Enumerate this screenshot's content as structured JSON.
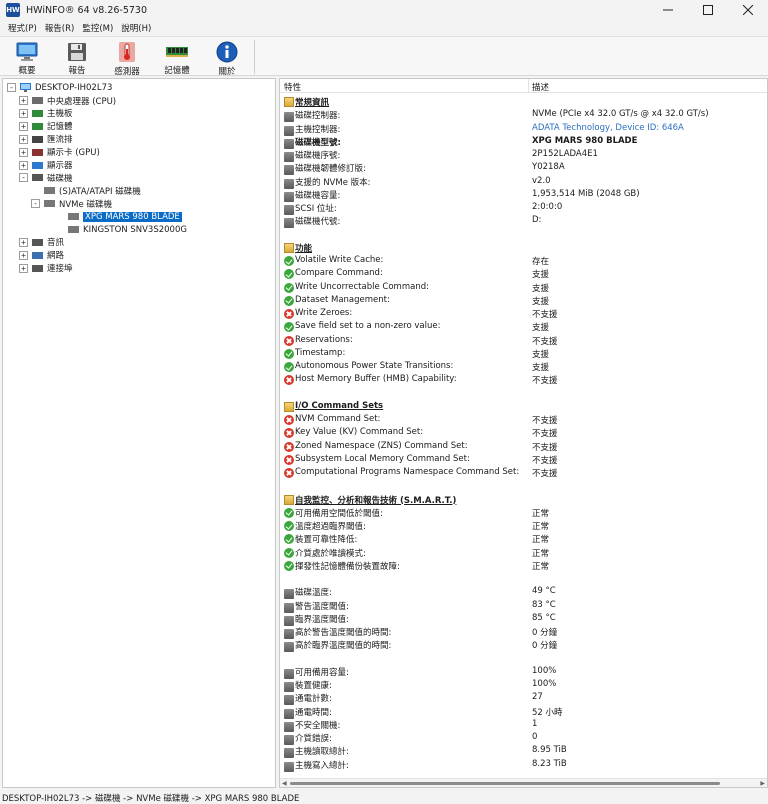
{
  "window": {
    "title": "HWiNFO® 64 v8.26-5730",
    "app_icon_text": "HW"
  },
  "menu": [
    "程式(P)",
    "報告(R)",
    "監控(M)",
    "說明(H)"
  ],
  "toolbar": [
    {
      "label": "概要",
      "icon": "monitor-icon"
    },
    {
      "label": "報告",
      "icon": "floppy-icon"
    },
    {
      "label": "感測器",
      "icon": "thermometer-icon"
    },
    {
      "label": "記憶體",
      "icon": "memory-module-icon"
    },
    {
      "label": "關於",
      "icon": "info-icon"
    }
  ],
  "tree": {
    "root": "DESKTOP-IH02L73",
    "items": [
      {
        "label": "中央處理器 (CPU)",
        "expander": "+",
        "level": 1
      },
      {
        "label": "主機板",
        "expander": "+",
        "level": 1
      },
      {
        "label": "記憶體",
        "expander": "+",
        "level": 1
      },
      {
        "label": "匯流排",
        "expander": "+",
        "level": 1
      },
      {
        "label": "顯示卡 (GPU)",
        "expander": "+",
        "level": 1
      },
      {
        "label": "顯示器",
        "expander": "+",
        "level": 1
      },
      {
        "label": "磁碟機",
        "expander": "-",
        "level": 1
      },
      {
        "label": "(S)ATA/ATAPI 磁碟機",
        "expander": "",
        "level": 2
      },
      {
        "label": "NVMe 磁碟機",
        "expander": "-",
        "level": 2
      },
      {
        "label": "XPG MARS 980 BLADE",
        "expander": "",
        "level": 3,
        "selected": true
      },
      {
        "label": "KINGSTON SNV3S2000G",
        "expander": "",
        "level": 3
      },
      {
        "label": "音訊",
        "expander": "+",
        "level": 1
      },
      {
        "label": "網路",
        "expander": "+",
        "level": 1
      },
      {
        "label": "連接埠",
        "expander": "+",
        "level": 1
      }
    ]
  },
  "details": {
    "header_feature": "特性",
    "header_desc": "描述",
    "rows": [
      {
        "t": "sec",
        "f": "常規資訊"
      },
      {
        "t": "dev",
        "f": "磁碟控制器:",
        "v": "NVMe (PCIe x4 32.0 GT/s @ x4 32.0 GT/s)"
      },
      {
        "t": "dev",
        "f": "主機控制器:",
        "v": "ADATA Technology, Device ID: 646A",
        "link": true
      },
      {
        "t": "dev",
        "f": "磁碟機型號:",
        "v": "XPG MARS 980 BLADE",
        "bold": true
      },
      {
        "t": "dev",
        "f": "磁碟機序號:",
        "v": "2P152LADA4E1"
      },
      {
        "t": "dev",
        "f": "磁碟機韌體修訂版:",
        "v": "Y0218A"
      },
      {
        "t": "dev",
        "f": "支援的 NVMe 版本:",
        "v": "v2.0"
      },
      {
        "t": "dev",
        "f": "磁碟機容量:",
        "v": "1,953,514 MiB (2048 GB)"
      },
      {
        "t": "dev",
        "f": "SCSI 位址:",
        "v": "2:0:0:0"
      },
      {
        "t": "dev",
        "f": "磁碟機代號:",
        "v": "D:"
      },
      {
        "t": "blank"
      },
      {
        "t": "sec",
        "f": "功能"
      },
      {
        "t": "ok",
        "f": "Volatile Write Cache:",
        "v": "存在"
      },
      {
        "t": "ok",
        "f": "Compare Command:",
        "v": "支援"
      },
      {
        "t": "ok",
        "f": "Write Uncorrectable Command:",
        "v": "支援"
      },
      {
        "t": "ok",
        "f": "Dataset Management:",
        "v": "支援"
      },
      {
        "t": "no",
        "f": "Write Zeroes:",
        "v": "不支援"
      },
      {
        "t": "ok",
        "f": "Save field set to a non-zero value:",
        "v": "支援"
      },
      {
        "t": "no",
        "f": "Reservations:",
        "v": "不支援"
      },
      {
        "t": "ok",
        "f": "Timestamp:",
        "v": "支援"
      },
      {
        "t": "ok",
        "f": "Autonomous Power State Transitions:",
        "v": "支援"
      },
      {
        "t": "no",
        "f": "Host Memory Buffer (HMB) Capability:",
        "v": "不支援"
      },
      {
        "t": "blank"
      },
      {
        "t": "sec",
        "f": "I/O Command Sets"
      },
      {
        "t": "no",
        "f": "NVM Command Set:",
        "v": "不支援"
      },
      {
        "t": "no",
        "f": "Key Value (KV) Command Set:",
        "v": "不支援"
      },
      {
        "t": "no",
        "f": "Zoned Namespace (ZNS) Command Set:",
        "v": "不支援"
      },
      {
        "t": "no",
        "f": "Subsystem Local Memory Command Set:",
        "v": "不支援"
      },
      {
        "t": "no",
        "f": "Computational Programs Namespace Command Set:",
        "v": "不支援"
      },
      {
        "t": "blank"
      },
      {
        "t": "sec",
        "f": "自我監控、分析和報告技術 (S.M.A.R.T.)"
      },
      {
        "t": "ok",
        "f": "可用備用空間低於閾值:",
        "v": "正常"
      },
      {
        "t": "ok",
        "f": "溫度超過臨界閾值:",
        "v": "正常"
      },
      {
        "t": "ok",
        "f": "裝置可靠性降低:",
        "v": "正常"
      },
      {
        "t": "ok",
        "f": "介質處於唯讀模式:",
        "v": "正常"
      },
      {
        "t": "ok",
        "f": "揮發性記憶體備份裝置故障:",
        "v": "正常"
      },
      {
        "t": "blank"
      },
      {
        "t": "dev",
        "f": "磁碟溫度:",
        "v": "49 °C"
      },
      {
        "t": "dev",
        "f": "警告溫度閾值:",
        "v": "83 °C"
      },
      {
        "t": "dev",
        "f": "臨界溫度閾值:",
        "v": "85 °C"
      },
      {
        "t": "dev",
        "f": "高於警告溫度閾值的時間:",
        "v": "0 分鐘"
      },
      {
        "t": "dev",
        "f": "高於臨界溫度閾值的時間:",
        "v": "0 分鐘"
      },
      {
        "t": "blank"
      },
      {
        "t": "dev",
        "f": "可用備用容量:",
        "v": "100%"
      },
      {
        "t": "dev",
        "f": "裝置健康:",
        "v": "100%"
      },
      {
        "t": "dev",
        "f": "通電計數:",
        "v": "27"
      },
      {
        "t": "dev",
        "f": "通電時間:",
        "v": "52 小時"
      },
      {
        "t": "dev",
        "f": "不安全關機:",
        "v": "1"
      },
      {
        "t": "dev",
        "f": "介質錯誤:",
        "v": "0"
      },
      {
        "t": "dev",
        "f": "主機讀取總計:",
        "v": "8.95 TiB"
      },
      {
        "t": "dev",
        "f": "主機寫入總計:",
        "v": "8.23 TiB"
      }
    ]
  },
  "status": "DESKTOP-IH02L73 -> 磁碟機 -> NVMe 磁碟機 -> XPG MARS 980 BLADE"
}
